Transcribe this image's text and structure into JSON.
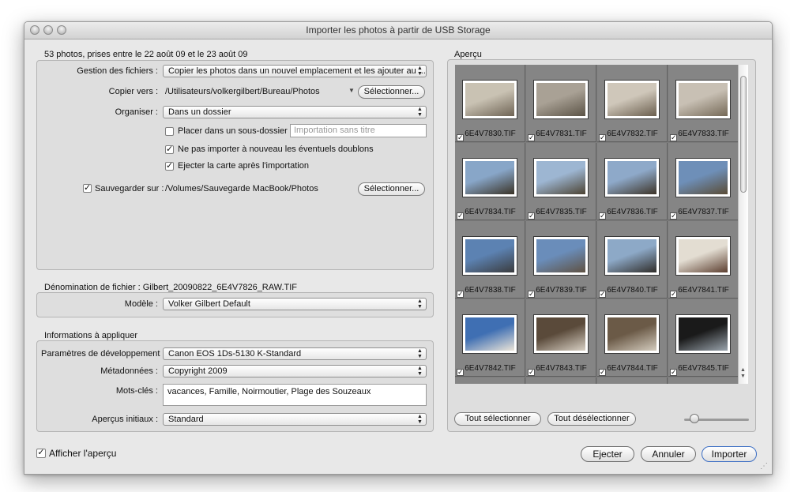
{
  "window": {
    "title": "Importer les photos à partir de USB Storage"
  },
  "import_group": {
    "header": "53 photos, prises entre le 22 août 09 et le 23 août 09",
    "file_handling": {
      "label": "Gestion des fichiers :",
      "value": "Copier les photos dans un nouvel emplacement et les ajouter au ..."
    },
    "copy_to": {
      "label": "Copier vers :",
      "path": "/Utilisateurs/volkergilbert/Bureau/Photos",
      "button": "Sélectionner..."
    },
    "organize": {
      "label": "Organiser :",
      "value": "Dans un dossier"
    },
    "subfolder": {
      "label": "Placer dans un sous-dossier :",
      "checked": false,
      "placeholder": "Importation sans titre"
    },
    "no_duplicates": {
      "label": "Ne pas importer à nouveau les éventuels doublons",
      "checked": true
    },
    "eject_after": {
      "label": "Ejecter la carte après l'importation",
      "checked": true
    },
    "backup": {
      "label": "Sauvegarder sur :",
      "checked": true,
      "path": "/Volumes/Sauvegarde MacBook/Photos",
      "button": "Sélectionner..."
    }
  },
  "naming_group": {
    "header": "Dénomination de fichier : Gilbert_20090822_6E4V7826_RAW.TIF",
    "template": {
      "label": "Modèle :",
      "value": "Volker Gilbert Default"
    }
  },
  "apply_group": {
    "header": "Informations à appliquer",
    "develop": {
      "label": "Paramètres de développement :",
      "value": "Canon EOS 1Ds-5130 K-Standard"
    },
    "metadata": {
      "label": "Métadonnées :",
      "value": "Copyright 2009"
    },
    "keywords": {
      "label": "Mots-clés :",
      "value": "vacances, Famille, Noirmoutier, Plage des Souzeaux"
    },
    "previews": {
      "label": "Aperçus initiaux :",
      "value": "Standard"
    }
  },
  "preview": {
    "header": "Aperçu",
    "select_all": "Tout sélectionner",
    "deselect_all": "Tout désélectionner",
    "thumbnail_size": 0.1,
    "photos": [
      {
        "name": "6E4V7830.TIF",
        "checked": true,
        "a": "#c9c2b3",
        "b": "#6e6354"
      },
      {
        "name": "6E4V7831.TIF",
        "checked": true,
        "a": "#a9a195",
        "b": "#5b5346"
      },
      {
        "name": "6E4V7832.TIF",
        "checked": true,
        "a": "#cfc7ba",
        "b": "#6a5e4d"
      },
      {
        "name": "6E4V7833.TIF",
        "checked": true,
        "a": "#c8c0b4",
        "b": "#756957"
      },
      {
        "name": "6E4V7834.TIF",
        "checked": true,
        "a": "#88a6c8",
        "b": "#3a3326"
      },
      {
        "name": "6E4V7835.TIF",
        "checked": true,
        "a": "#9db6d2",
        "b": "#4c4332"
      },
      {
        "name": "6E4V7836.TIF",
        "checked": true,
        "a": "#8ea9c9",
        "b": "#3d3427"
      },
      {
        "name": "6E4V7837.TIF",
        "checked": true,
        "a": "#6e8fb8",
        "b": "#5a4c36"
      },
      {
        "name": "6E4V7838.TIF",
        "checked": true,
        "a": "#5c82b2",
        "b": "#3a3b3d"
      },
      {
        "name": "6E4V7839.TIF",
        "checked": true,
        "a": "#6a8dba",
        "b": "#5f5142"
      },
      {
        "name": "6E4V7840.TIF",
        "checked": true,
        "a": "#8da9c7",
        "b": "#2f2c28"
      },
      {
        "name": "6E4V7841.TIF",
        "checked": true,
        "a": "#e3ddd2",
        "b": "#5b3d2e"
      },
      {
        "name": "6E4V7842.TIF",
        "checked": true,
        "a": "#3f6fb3",
        "b": "#ece5d8"
      },
      {
        "name": "6E4V7843.TIF",
        "checked": true,
        "a": "#5a4a3a",
        "b": "#d8d0c4"
      },
      {
        "name": "6E4V7844.TIF",
        "checked": true,
        "a": "#6b5a47",
        "b": "#d4ccbe"
      },
      {
        "name": "6E4V7845.TIF",
        "checked": true,
        "a": "#1a1a1a",
        "b": "#9aa4ad"
      },
      {
        "name": "",
        "checked": false,
        "a": "#1e1e1e",
        "b": "#b8b8b8"
      },
      {
        "name": "",
        "checked": false,
        "a": "#252525",
        "b": "#c2c2c2"
      },
      {
        "name": "",
        "checked": false,
        "a": "#1b1b1b",
        "b": "#bcbcbc"
      },
      {
        "name": "",
        "checked": false,
        "a": "#ded7cc",
        "b": "#3d2c22"
      }
    ]
  },
  "footer": {
    "show_preview": {
      "label": "Afficher l'aperçu",
      "checked": true
    },
    "eject": "Ejecter",
    "cancel": "Annuler",
    "import": "Importer"
  }
}
